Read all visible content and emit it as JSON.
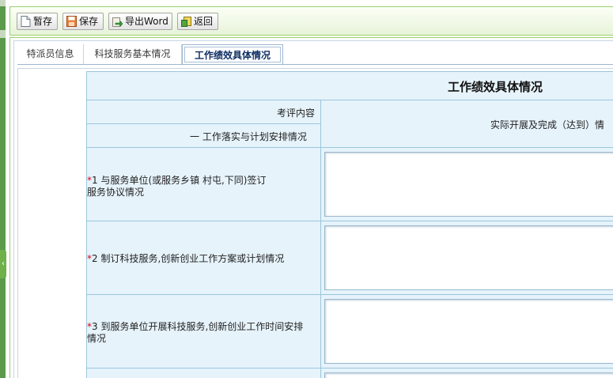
{
  "toolbar": {
    "buttons": [
      {
        "label": "暂存",
        "icon": "document-icon"
      },
      {
        "label": "保存",
        "icon": "floppy-save-icon"
      },
      {
        "label": "导出Word",
        "icon": "export-arrow-icon"
      },
      {
        "label": "返回",
        "icon": "back-icon"
      }
    ]
  },
  "tabs": [
    {
      "label": "特派员信息",
      "active": false
    },
    {
      "label": "科技服务基本情况",
      "active": false
    },
    {
      "label": "工作绩效具体情况",
      "active": true
    }
  ],
  "form": {
    "title": "工作绩效具体情况",
    "header_left": "考评内容",
    "header_right": "实际开展及完成（达到）情",
    "section_label": "一  工作落实与计划安排情况",
    "items": [
      {
        "required_mark": "*",
        "text": "1 与服务单位(或服务乡镇 村屯,下同)签订服务协议情况",
        "line1": "1 与服务单位(或服务乡镇 村屯,下同)签订",
        "line2": "服务协议情况",
        "value": ""
      },
      {
        "required_mark": "*",
        "text": "2 制订科技服务,创新创业工作方案或计划情况",
        "line1": "2 制订科技服务,创新创业工作方案或计划情况",
        "line2": "",
        "value": ""
      },
      {
        "required_mark": "*",
        "text": "3 到服务单位开展科技服务,创新创业工作时间安排情况",
        "line1": "3 到服务单位开展科技服务,创新创业工作时间安排",
        "line2": "情况",
        "value": ""
      }
    ]
  },
  "colors": {
    "toolbar_border": "#9ccf72",
    "table_header_bg": "#e6f3fb",
    "table_border": "#9cc6dc",
    "required": "#e0001b",
    "active_tab_text": "#0e2f63"
  }
}
